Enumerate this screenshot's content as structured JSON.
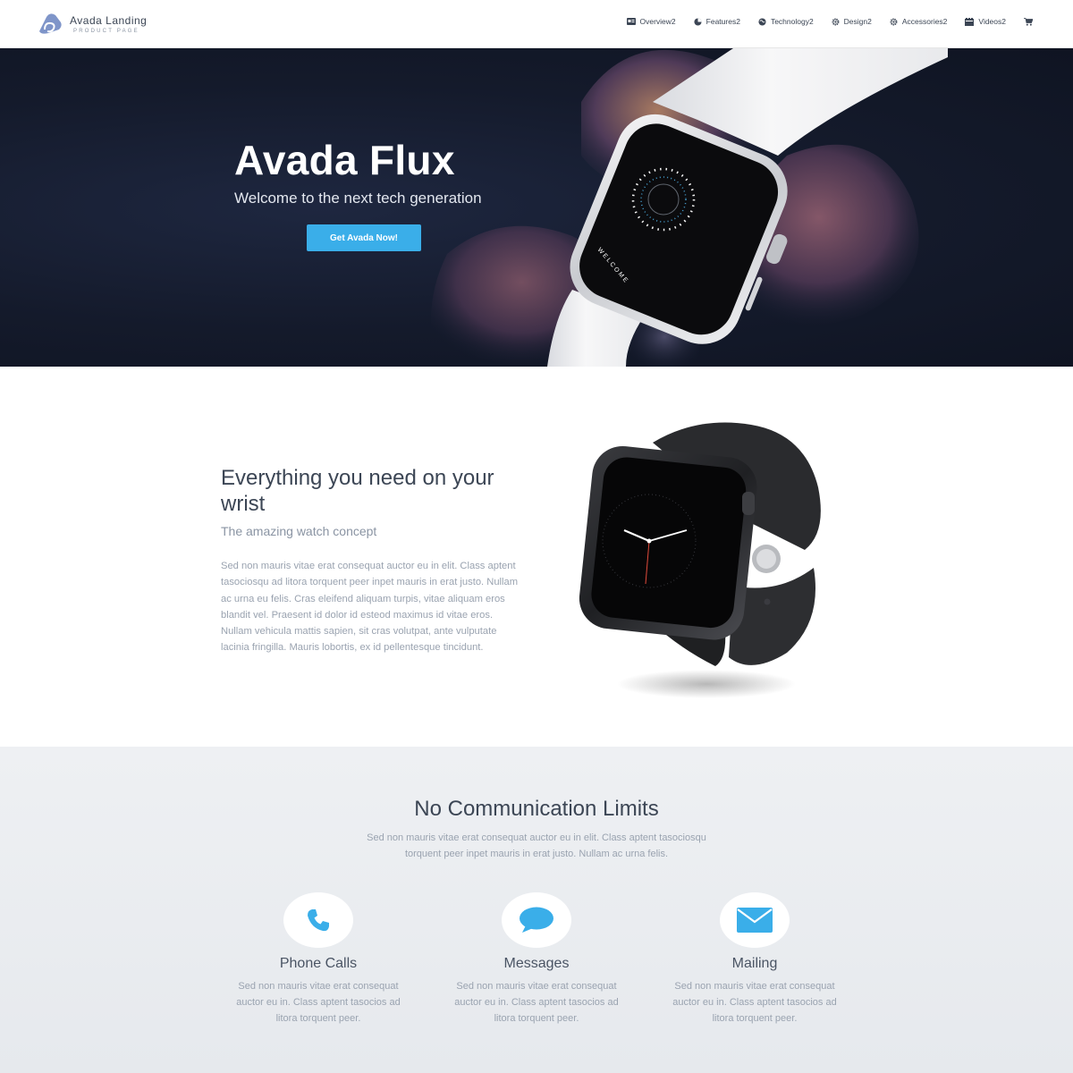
{
  "brand": {
    "title": "Avada Landing",
    "subtitle": "PRODUCT PAGE"
  },
  "nav": [
    {
      "label": "Overview2",
      "icon": "id-card-icon"
    },
    {
      "label": "Features2",
      "icon": "pie-chart-icon"
    },
    {
      "label": "Technology2",
      "icon": "globe-icon"
    },
    {
      "label": "Design2",
      "icon": "cog-icon"
    },
    {
      "label": "Accessories2",
      "icon": "gear-icon"
    },
    {
      "label": "Videos2",
      "icon": "film-icon"
    }
  ],
  "cart_icon": "shopping-cart-icon",
  "hero": {
    "title": "Avada Flux",
    "subtitle": "Welcome to the next tech generation",
    "button": "Get Avada Now!",
    "watch_screen_text": "WELCOME"
  },
  "wrist": {
    "title": "Everything you need on your wrist",
    "subtitle": "The amazing watch concept",
    "body": "Sed non mauris vitae erat consequat auctor eu in elit. Class aptent tasociosqu ad litora torquent peer inpet mauris in erat justo. Nullam ac urna eu felis. Cras eleifend aliquam turpis, vitae aliquam eros blandit vel. Praesent id dolor id esteod maximus id vitae eros. Nullam vehicula mattis sapien, sit cras volutpat, ante vulputate lacinia fringilla. Mauris lobortis, ex id pellentesque tincidunt."
  },
  "comm": {
    "title": "No Communication Limits",
    "text": "Sed non mauris vitae erat consequat auctor eu in elit. Class aptent tasociosqu torquent peer inpet mauris in erat justo. Nullam ac urna felis.",
    "features": [
      {
        "title": "Phone Calls",
        "icon": "phone-icon",
        "text": "Sed non mauris vitae erat consequat auctor eu in. Class aptent tasocios ad litora torquent peer."
      },
      {
        "title": "Messages",
        "icon": "chat-bubble-icon",
        "text": "Sed non mauris vitae erat consequat auctor eu in. Class aptent tasocios ad litora torquent peer."
      },
      {
        "title": "Mailing",
        "icon": "envelope-icon",
        "text": "Sed non mauris vitae erat consequat auctor eu in. Class aptent tasocios ad litora torquent peer."
      }
    ]
  },
  "colors": {
    "accent": "#3aaee9",
    "heading": "#3c4655",
    "muted": "#9aa3b0",
    "hero_bg": "#141a2b"
  }
}
